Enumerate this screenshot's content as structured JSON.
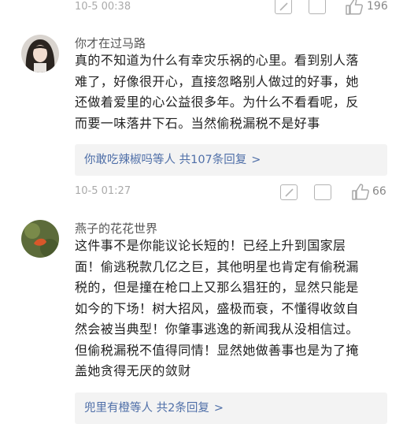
{
  "top_bar": {
    "timestamp": "10-5 00:38",
    "like_count": "196"
  },
  "comments": [
    {
      "username": "你才在过马路",
      "lines": [
        "真的不知道为什么有幸灾乐祸的心里。看到别人落",
        "难了，好像很开心，直接忽略别人做过的好事，她",
        "还做着爱里的心公益很多年。为什么不看看呢，反",
        "而要一味落井下石。当然偷税漏税不是好事"
      ],
      "reply_summary": "你敢吃辣椒吗等人 共107条回复",
      "reply_chevron": ">",
      "timestamp": "10-5 01:27",
      "like_count": "66"
    },
    {
      "username": "燕子的花花世界",
      "lines": [
        "这件事不是你能议论长短的！已经上升到国家层",
        "面！偷逃税款几亿之巨，其他明星也肯定有偷税漏",
        "税的，但是撞在枪口上又那么猖狂的，显然只能是",
        "如今的下场！树大招风，盛极而衰，不懂得收敛自",
        "然会被当典型！你肇事逃逸的新闻我从没相信过。",
        "但偷税漏税不值得同情！显然她做善事也是为了掩",
        "盖她贪得无厌的敛财"
      ],
      "reply_summary": "兜里有橙等人 共2条回复",
      "reply_chevron": ">"
    }
  ]
}
